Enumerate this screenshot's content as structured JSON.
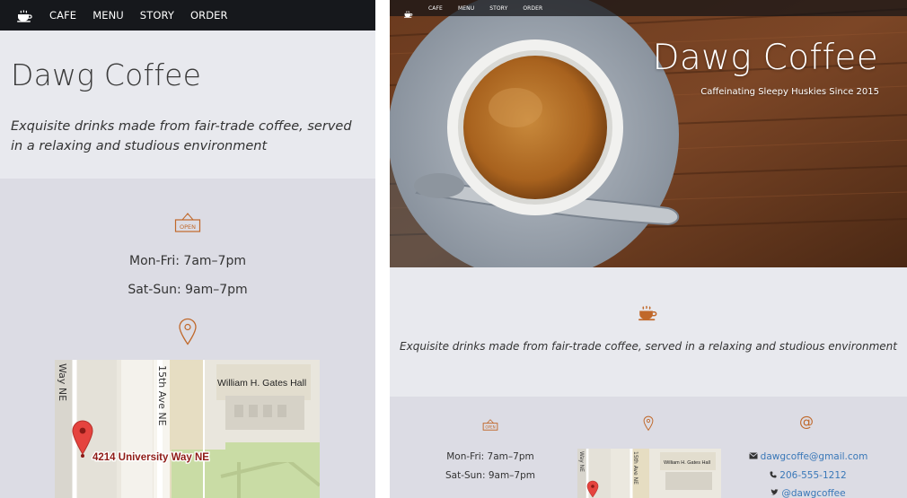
{
  "colors": {
    "accent": "#c0682a",
    "nav_bg": "#16181c",
    "link": "#3a78b8",
    "section_light": "#e8e9ee",
    "section_dark": "#dcdce4"
  },
  "nav": {
    "logo_icon": "coffee-cup-icon",
    "items": [
      "CAFE",
      "MENU",
      "STORY",
      "ORDER"
    ]
  },
  "mobile": {
    "brand": "Dawg Coffee",
    "tagline": "Exquisite drinks made from fair-trade coffee, served in a relaxing and studious environment",
    "hours": [
      "Mon-Fri: 7am–7pm",
      "Sat-Sun: 9am–7pm"
    ],
    "open_sign_text": "OPEN",
    "map": {
      "street_vertical": "Way NE",
      "avenue_label": "15th Ave NE",
      "building_label": "William H. Gates Hall",
      "marker_label": "4214 University Way NE"
    }
  },
  "desktop": {
    "brand": "Dawg Coffee",
    "subtitle": "Caffeinating Sleepy Huskies Since 2015",
    "intro": "Exquisite drinks made from fair-trade coffee, served in a relaxing and studious environment",
    "hours": [
      "Mon-Fri: 7am–7pm",
      "Sat-Sun: 9am–7pm"
    ],
    "open_sign_text": "OPEN",
    "at_symbol": "@",
    "map": {
      "street_vertical": "Way NE",
      "avenue_label": "15th Ave NE",
      "building_label": "William H. Gates Hall"
    },
    "contact": {
      "email": "dawgcoffe@gmail.com",
      "phone": "206-555-1212",
      "twitter": "@dawgcoffee"
    }
  }
}
